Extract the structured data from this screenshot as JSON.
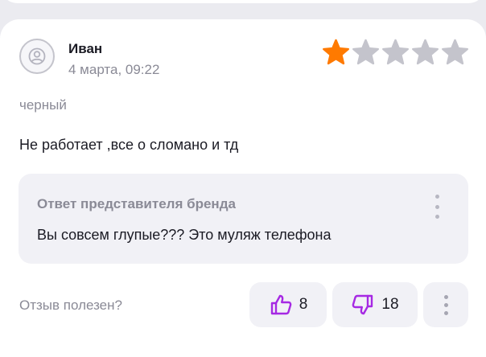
{
  "review": {
    "author": "Иван",
    "date": "4 марта, 09:22",
    "rating": 1,
    "rating_max": 5,
    "variant": "черный",
    "text": "Не работает ,все о сломано и тд"
  },
  "brand_answer": {
    "title": "Ответ представителя бренда",
    "text": "Вы совсем глупые??? Это муляж телефона"
  },
  "feedback": {
    "label": "Отзыв полезен?",
    "likes": "8",
    "dislikes": "18"
  },
  "icons": {
    "avatar": "user-placeholder-icon",
    "like": "thumbs-up-icon",
    "dislike": "thumbs-down-icon",
    "menu": "more-vertical-icon"
  },
  "colors": {
    "star_active": "#ff7a00",
    "star_inactive": "#c4c4cc",
    "accent": "#a629e3"
  }
}
